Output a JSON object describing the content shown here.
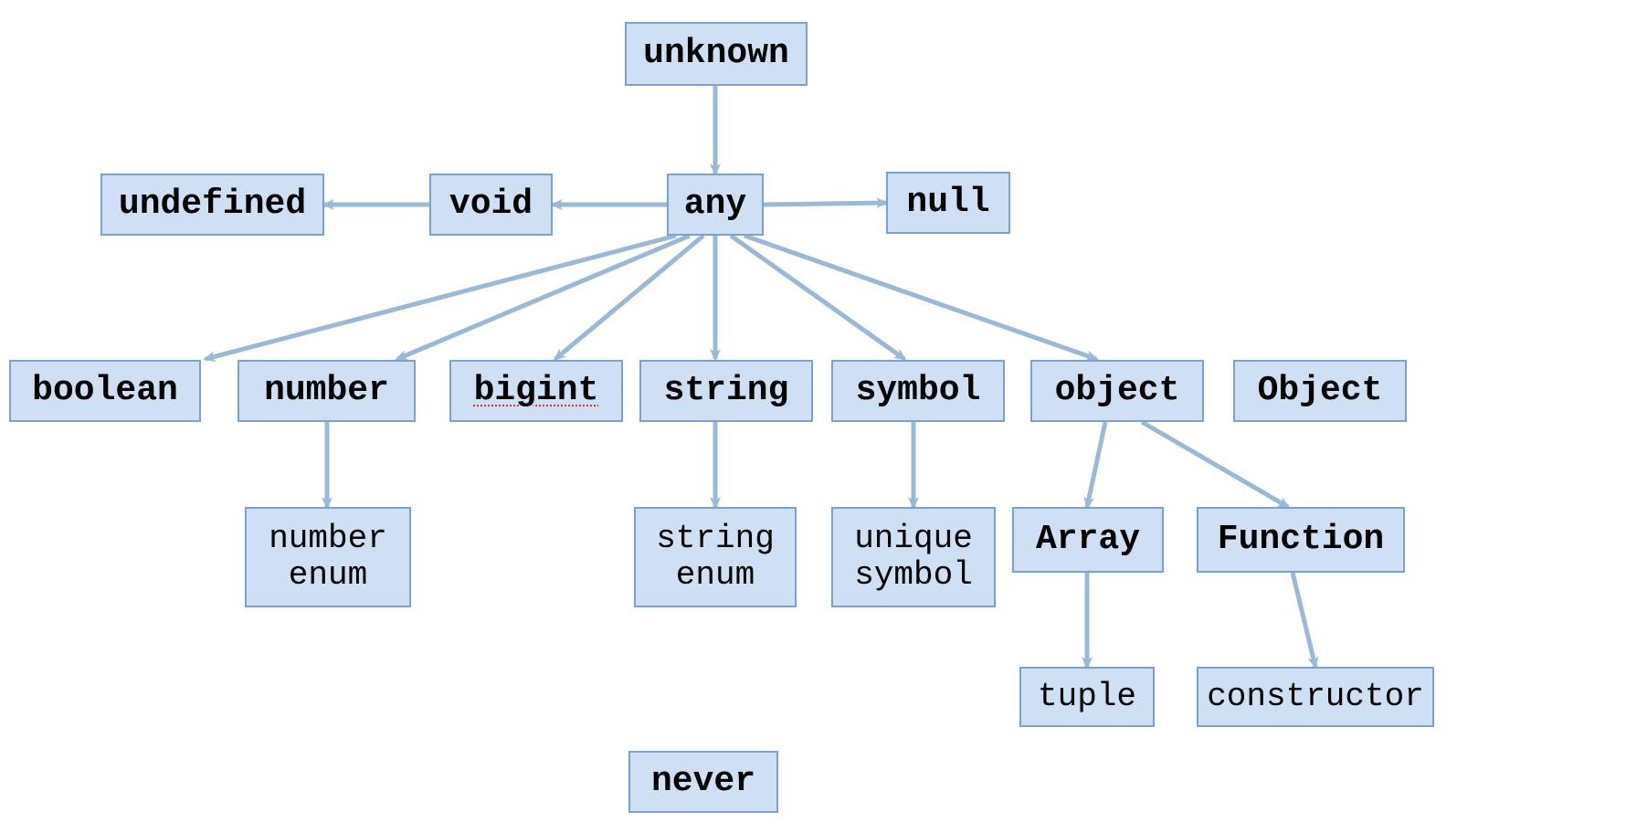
{
  "colors": {
    "node_fill": "#cfe0f4",
    "node_border": "#7aa2cc",
    "edge": "#9ab8d8",
    "text": "#000000"
  },
  "nodes": {
    "unknown": {
      "label": "unknown"
    },
    "undefined": {
      "label": "undefined"
    },
    "void": {
      "label": "void"
    },
    "any": {
      "label": "any"
    },
    "null": {
      "label": "null"
    },
    "boolean": {
      "label": "boolean"
    },
    "number": {
      "label": "number"
    },
    "bigint": {
      "label": "bigint"
    },
    "string": {
      "label": "string"
    },
    "symbol": {
      "label": "symbol"
    },
    "object_lc": {
      "label": "object"
    },
    "object_uc": {
      "label": "Object"
    },
    "number_enum": {
      "label": "number\nenum"
    },
    "string_enum": {
      "label": "string\nenum"
    },
    "unique_symbol": {
      "label": "unique\nsymbol"
    },
    "array": {
      "label": "Array"
    },
    "function": {
      "label": "Function"
    },
    "tuple": {
      "label": "tuple"
    },
    "constructor": {
      "label": "constructor"
    },
    "never": {
      "label": "never"
    }
  },
  "edges": [
    {
      "from": "unknown",
      "to": "any"
    },
    {
      "from": "any",
      "to": "void"
    },
    {
      "from": "void",
      "to": "undefined"
    },
    {
      "from": "any",
      "to": "null"
    },
    {
      "from": "any",
      "to": "boolean"
    },
    {
      "from": "any",
      "to": "number"
    },
    {
      "from": "any",
      "to": "bigint"
    },
    {
      "from": "any",
      "to": "string"
    },
    {
      "from": "any",
      "to": "symbol"
    },
    {
      "from": "any",
      "to": "object_lc"
    },
    {
      "from": "number",
      "to": "number_enum"
    },
    {
      "from": "string",
      "to": "string_enum"
    },
    {
      "from": "symbol",
      "to": "unique_symbol"
    },
    {
      "from": "object_lc",
      "to": "array"
    },
    {
      "from": "object_lc",
      "to": "function"
    },
    {
      "from": "array",
      "to": "tuple"
    },
    {
      "from": "function",
      "to": "constructor"
    }
  ]
}
